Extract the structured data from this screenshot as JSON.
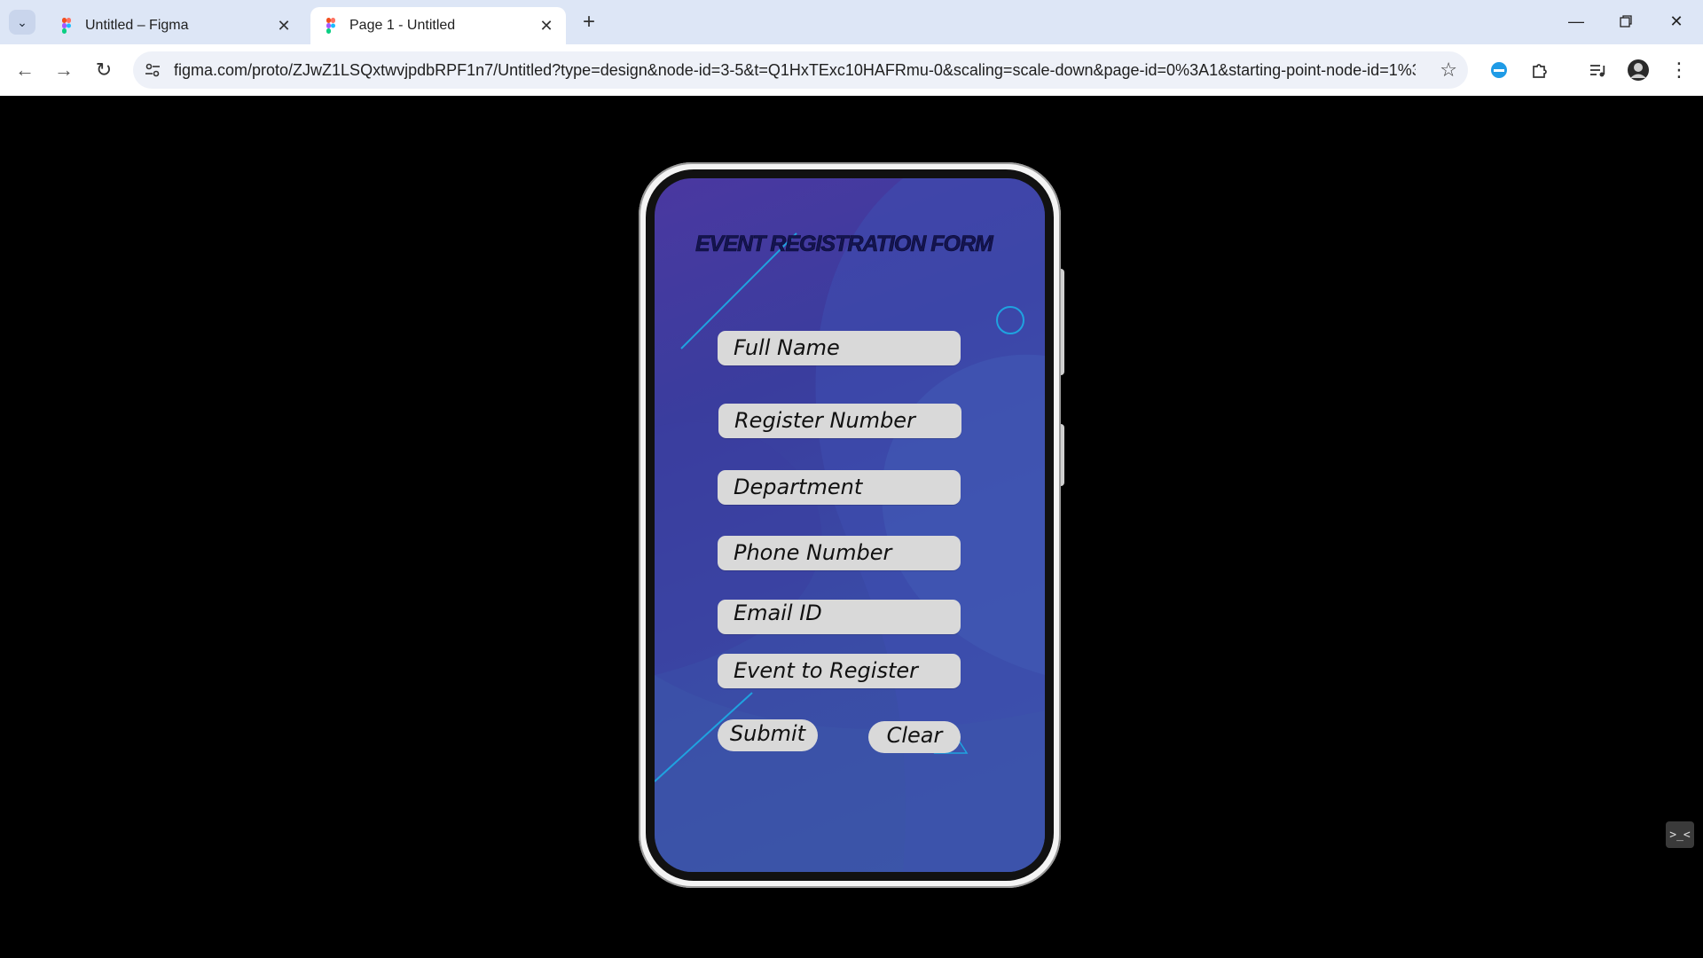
{
  "browser": {
    "tabs": [
      {
        "title": "Untitled – Figma",
        "active": false
      },
      {
        "title": "Page 1 - Untitled",
        "active": true
      }
    ],
    "url": "figma.com/proto/ZJwZ1LSQxtwvjpdbRPF1n7/Untitled?type=design&node-id=3-5&t=Q1HxTExc10HAFRmu-0&scaling=scale-down&page-id=0%3A1&starting-point-node-id=1%3A2",
    "icons": {
      "tab_list": "chevron-down-icon",
      "new_tab": "plus-icon",
      "back": "arrow-left-icon",
      "forward": "arrow-right-icon",
      "reload": "reload-icon",
      "site_info": "tune-icon",
      "bookmark": "star-icon",
      "extension_active": "extension-icon",
      "extensions": "puzzle-icon",
      "media": "media-queue-icon",
      "profile": "avatar",
      "menu": "more-vertical-icon"
    }
  },
  "form": {
    "title": "EVENT REGISTRATION FORM",
    "fields": [
      {
        "label": "Full Name"
      },
      {
        "label": "Register Number"
      },
      {
        "label": "Department"
      },
      {
        "label": "Phone Number"
      },
      {
        "label": "Email ID"
      },
      {
        "label": "Event to Register"
      }
    ],
    "submit_label": "Submit",
    "clear_label": "Clear"
  },
  "colors": {
    "screen_gradient_start": "#4a38a0",
    "screen_gradient_end": "#3b56a8",
    "accent_line": "#1fa3e0",
    "field_bg": "#d9d9d9",
    "title_color": "#141450"
  },
  "devtools_toggle_label": ">_<"
}
